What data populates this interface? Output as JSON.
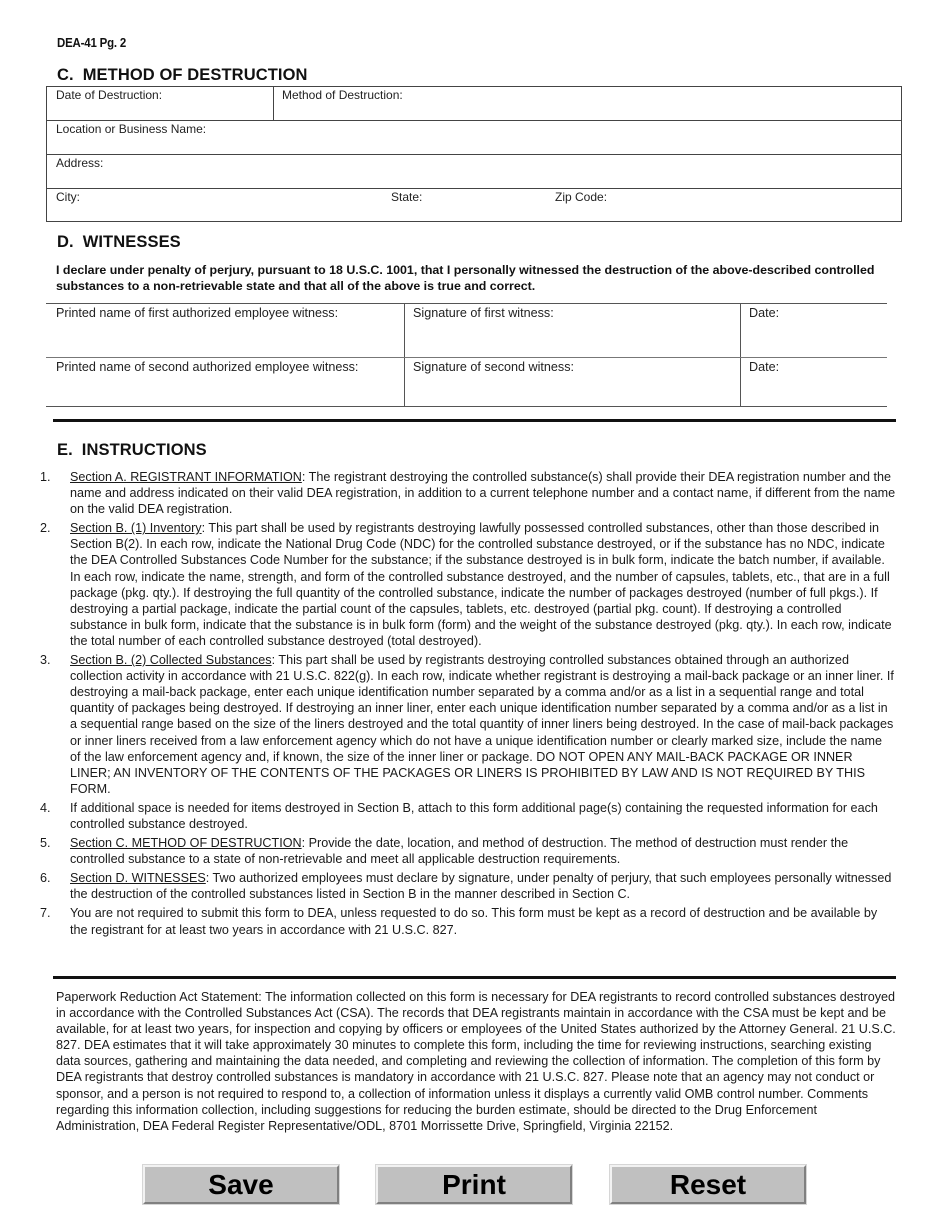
{
  "form_id": "DEA-41  Pg. 2",
  "section_c": {
    "letter": "C.",
    "title": "METHOD OF DESTRUCTION",
    "fields": {
      "date_of_destruction": {
        "label": "Date of Destruction:",
        "value": ""
      },
      "method_of_destruction": {
        "label": "Method of Destruction:",
        "value": ""
      },
      "location_or_business_name": {
        "label": "Location or Business Name:",
        "value": ""
      },
      "address": {
        "label": "Address:",
        "value": ""
      },
      "city": {
        "label": "City:",
        "value": ""
      },
      "state": {
        "label": "State:",
        "value": ""
      },
      "zip_code": {
        "label": "Zip  Code:",
        "value": ""
      }
    }
  },
  "section_d": {
    "letter": "D.",
    "title": "WITNESSES",
    "declaration": "I declare under penalty of perjury, pursuant to 18 U.S.C. 1001, that I personally witnessed the destruction of the above-described controlled substances to a non-retrievable state and that all of the above is true and correct.",
    "rows": [
      {
        "name_label": "Printed name of first authorized employee witness:",
        "signature_label": "Signature of first witness:",
        "date_label": "Date:"
      },
      {
        "name_label": "Printed name of second authorized employee witness:",
        "signature_label": "Signature of second witness:",
        "date_label": "Date:"
      }
    ]
  },
  "section_e": {
    "letter": "E.",
    "title": "INSTRUCTIONS",
    "items": [
      {
        "num": "1.",
        "heading": "Section A. REGISTRANT INFORMATION",
        "text": ":  The registrant destroying the controlled substance(s) shall provide their DEA registration number and the name and address indicated on their valid DEA registration, in addition to a current telephone number and a contact name, if different from the name on the valid DEA registration."
      },
      {
        "num": "2.",
        "heading": "Section B. (1) Inventory",
        "text": ":  This part shall be used by registrants destroying lawfully possessed controlled substances, other than those described in Section B(2).  In each row, indicate the National Drug Code (NDC) for the controlled substance destroyed, or if the substance has no NDC, indicate the DEA Controlled Substances Code Number for the substance; if the substance destroyed is in bulk form, indicate the batch number, if available.  In each row, indicate the name, strength, and form of the controlled substance destroyed, and the number of capsules, tablets, etc., that are in a full package (pkg. qty.).  If destroying the full quantity of the controlled substance, indicate the number of packages destroyed (number of full pkgs.).  If destroying a partial package, indicate the partial count of the capsules, tablets, etc. destroyed (partial pkg. count).  If destroying a controlled substance in bulk form, indicate that the substance is in bulk form (form) and the weight of the substance destroyed (pkg. qty.).  In each row, indicate the total number of each controlled substance destroyed (total destroyed)."
      },
      {
        "num": "3.",
        "heading": "Section B. (2) Collected Substances",
        "text": ":  This part shall be used by registrants destroying controlled substances obtained through an authorized collection activity in accordance with 21 U.S.C. 822(g).  In each row, indicate whether registrant is destroying a mail-back package or an inner liner.  If destroying a mail-back package, enter each unique identification number separated by a comma and/or as a list in a sequential range and total quantity of packages being destroyed.  If destroying an inner liner, enter each unique identification number separated by a comma and/or as a list in a sequential range based on the size of the liners destroyed and the total quantity of inner liners being destroyed.  In the case of mail-back packages or inner liners received from a law enforcement agency which do not have a unique identification number or clearly marked size, include the name of the law enforcement agency and, if known, the size of the inner liner or package.  DO NOT OPEN ANY MAIL-BACK PACKAGE OR INNER LINER; AN INVENTORY OF THE CONTENTS OF THE PACKAGES OR LINERS IS PROHIBITED BY LAW AND IS NOT REQUIRED BY THIS FORM."
      },
      {
        "num": "4.",
        "heading": "",
        "text": "If additional space is needed for items destroyed in Section B, attach to this form additional page(s) containing the requested information for each controlled substance destroyed."
      },
      {
        "num": "5.",
        "heading": "Section C. METHOD OF DESTRUCTION",
        "text": ":  Provide the date, location, and method of destruction.  The method of destruction must render the controlled substance to a state of non-retrievable and meet all applicable destruction requirements."
      },
      {
        "num": "6.",
        "heading": "Section D.  WITNESSES",
        "text": ":  Two authorized employees must declare by signature, under penalty of perjury, that such employees personally witnessed the destruction of the controlled substances listed in Section B in the manner described in Section C."
      },
      {
        "num": "7.",
        "heading": "",
        "text": "You are not required to submit this form to DEA, unless requested to do so.  This form must be kept as a record of destruction and be available by the registrant for at least two years in accordance with 21 U.S.C. 827."
      }
    ]
  },
  "paperwork_statement": "Paperwork Reduction Act Statement:  The information collected on this form is necessary for DEA registrants to record controlled substances destroyed in accordance with the Controlled Substances Act (CSA).  The records that DEA registrants maintain in accordance with the CSA must be kept and be available, for at least two years, for inspection and copying by officers or employees of the United States authorized by the Attorney General.  21 U.S.C. 827.  DEA estimates that it will take approximately 30 minutes to complete this form, including the time for reviewing instructions, searching existing data sources, gathering and maintaining the data needed, and completing and reviewing the collection of information.  The completion of this form by DEA registrants that destroy controlled substances is mandatory in accordance with 21 U.S.C. 827.  Please note that an agency may not conduct or sponsor, and a person is not required to respond to, a collection of information unless it displays a currently valid OMB control number.  Comments regarding this information collection, including suggestions for reducing the burden estimate, should be directed to the Drug Enforcement Administration, DEA Federal Register Representative/ODL, 8701 Morrissette Drive, Springfield, Virginia 22152.",
  "buttons": {
    "save": "Save",
    "print": "Print",
    "reset": "Reset"
  }
}
